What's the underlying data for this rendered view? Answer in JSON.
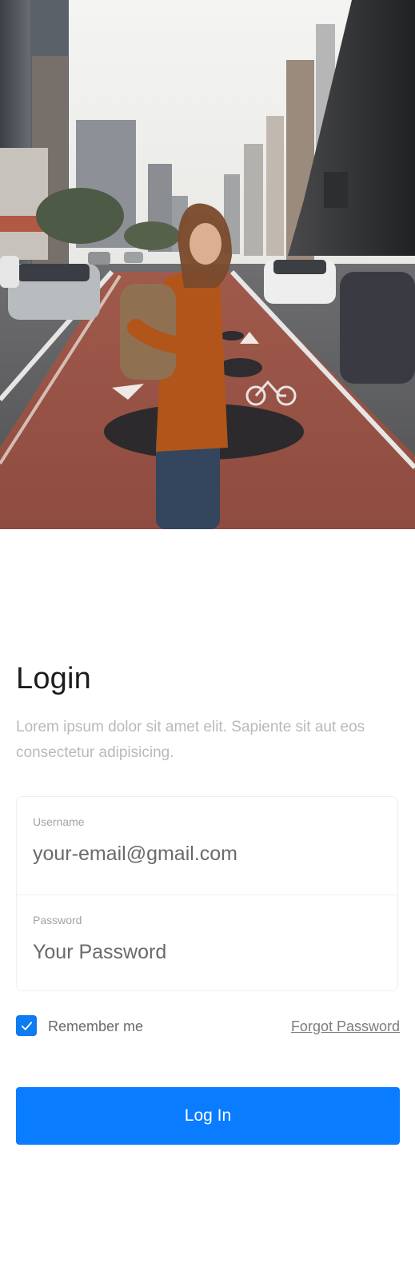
{
  "hero": {
    "image_description_icon": "hero-photo"
  },
  "login": {
    "title": "Login",
    "subtitle": "Lorem ipsum dolor sit amet elit. Sapiente sit aut eos consectetur adipisicing."
  },
  "form": {
    "username_label": "Username",
    "username_placeholder": "your-email@gmail.com",
    "password_label": "Password",
    "password_placeholder": "Your Password"
  },
  "options": {
    "remember_label": "Remember me",
    "remember_checked": true,
    "forgot_label": "Forgot Password"
  },
  "actions": {
    "login_label": "Log In"
  },
  "colors": {
    "accent": "#0a7cff",
    "checkbox": "#0d7bf2",
    "title": "#1c1c1c",
    "muted": "#b9b9b9"
  }
}
